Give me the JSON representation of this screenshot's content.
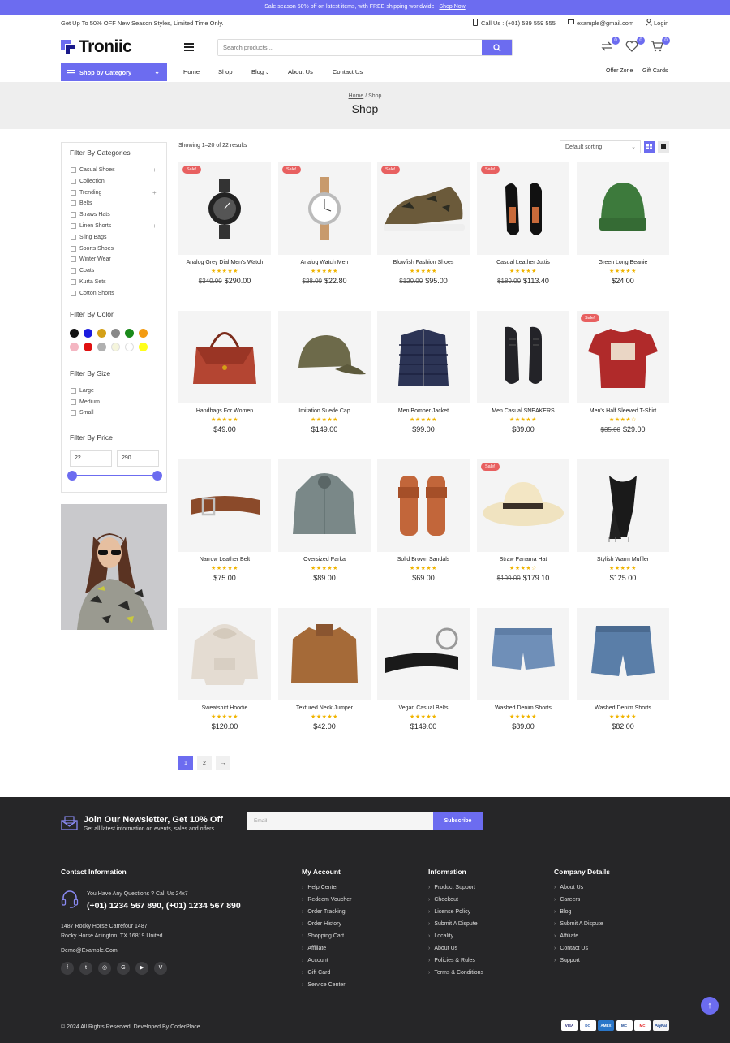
{
  "announcement": {
    "text": "Sale season 50% off on latest items, with FREE shipping worldwide",
    "link": "Shop Now"
  },
  "topbar": {
    "promo": "Get Up To 50% OFF New Season Styles, Limited Time Only.",
    "phone": "Call Us : (+01) 589 559 555",
    "email": "example@gmail.com",
    "login": "Login"
  },
  "brand": {
    "name": "Troniic"
  },
  "search": {
    "placeholder": "Search products..."
  },
  "header_icons": {
    "compare_count": "0",
    "wishlist_count": "0",
    "cart_count": "0"
  },
  "category_button": "Shop by Category",
  "nav": [
    "Home",
    "Shop",
    "Blog",
    "About Us",
    "Contact Us"
  ],
  "right_nav": [
    "Offer Zone",
    "Gift Cards"
  ],
  "hero": {
    "crumb_home": "Home",
    "crumb_sep": "/",
    "crumb_current": "Shop",
    "title": "Shop"
  },
  "filters": {
    "categories_title": "Filter By Categories",
    "categories": [
      "Casual Shoes",
      "Collection",
      "Trending",
      "Belts",
      "Straws Hats",
      "Linen Shorts",
      "Sling Bags",
      "Sports Shoes",
      "Winter Wear",
      "Coats",
      "Kurta Sets",
      "Cotton Shorts"
    ],
    "color_title": "Filter By Color",
    "colors": [
      "#111111",
      "#1a1adf",
      "#d4a017",
      "#888888",
      "#1a8a1a",
      "#f39c12",
      "#f4b6c2",
      "#e01010",
      "#b0b0b0",
      "#f5f5dc",
      "#ffffff",
      "#ffff1a"
    ],
    "size_title": "Filter By Size",
    "sizes": [
      "Large",
      "Medium",
      "Small"
    ],
    "price_title": "Filter By Price",
    "price_min": "22",
    "price_max": "290"
  },
  "results": {
    "text": "Showing 1–20 of 22 results",
    "sort": "Default sorting"
  },
  "products": [
    {
      "name": "Analog Grey Dial Men's Watch",
      "old": "$340.00",
      "price": "$290.00",
      "sale": "Sale!",
      "rating": 5
    },
    {
      "name": "Analog Watch Men",
      "old": "$28.00",
      "price": "$22.80",
      "sale": "Sale!",
      "rating": 5
    },
    {
      "name": "Blowfish Fashion Shoes",
      "old": "$120.00",
      "price": "$95.00",
      "sale": "Sale!",
      "rating": 5
    },
    {
      "name": "Casual Leather Juttis",
      "old": "$189.00",
      "price": "$113.40",
      "sale": "Sale!",
      "rating": 5
    },
    {
      "name": "Green Long Beanie",
      "old": "",
      "price": "$24.00",
      "sale": "",
      "rating": 5
    },
    {
      "name": "Handbags For Women",
      "old": "",
      "price": "$49.00",
      "sale": "",
      "rating": 5
    },
    {
      "name": "Imitation Suede Cap",
      "old": "",
      "price": "$149.00",
      "sale": "",
      "rating": 5
    },
    {
      "name": "Men Bomber Jacket",
      "old": "",
      "price": "$99.00",
      "sale": "",
      "rating": 5
    },
    {
      "name": "Men Casual SNEAKERS",
      "old": "",
      "price": "$89.00",
      "sale": "",
      "rating": 5
    },
    {
      "name": "Men's Half Sleeved T-Shirt",
      "old": "$35.00",
      "price": "$29.00",
      "sale": "Sale!",
      "rating": 4
    },
    {
      "name": "Narrow Leather Belt",
      "old": "",
      "price": "$75.00",
      "sale": "",
      "rating": 5
    },
    {
      "name": "Oversized Parka",
      "old": "",
      "price": "$89.00",
      "sale": "",
      "rating": 5
    },
    {
      "name": "Solid Brown Sandals",
      "old": "",
      "price": "$69.00",
      "sale": "",
      "rating": 5
    },
    {
      "name": "Straw Panama Hat",
      "old": "$199.00",
      "price": "$179.10",
      "sale": "Sale!",
      "rating": 4
    },
    {
      "name": "Stylish Warm Muffler",
      "old": "",
      "price": "$125.00",
      "sale": "",
      "rating": 5
    },
    {
      "name": "Sweatshirt Hoodie",
      "old": "",
      "price": "$120.00",
      "sale": "",
      "rating": 5
    },
    {
      "name": "Textured Neck Jumper",
      "old": "",
      "price": "$42.00",
      "sale": "",
      "rating": 5
    },
    {
      "name": "Vegan Casual Belts",
      "old": "",
      "price": "$149.00",
      "sale": "",
      "rating": 5
    },
    {
      "name": "Washed Denim Shorts",
      "old": "",
      "price": "$89.00",
      "sale": "",
      "rating": 5
    },
    {
      "name": "Washed Denim Shorts",
      "old": "",
      "price": "$82.00",
      "sale": "",
      "rating": 5
    }
  ],
  "pagination": {
    "p1": "1",
    "p2": "2",
    "next": "→"
  },
  "newsletter": {
    "title": "Join Our Newsletter, Get 10% Off",
    "sub": "Get all latest information on events, sales and offers",
    "placeholder": "Email",
    "button": "Subscribe"
  },
  "contact": {
    "title": "Contact Information",
    "question": "You Have Any Questions ? Call Us 24x7",
    "phones": "(+01) 1234 567 890, (+01) 1234 567 890",
    "address1": "1487 Rocky Horse Carrefour 1487",
    "address2": "Rocky Horse Arlington, TX 16819 United",
    "email": "Demo@Example.Com",
    "social": [
      "f",
      "t",
      "◎",
      "G",
      "▶",
      "V"
    ]
  },
  "my_account": {
    "title": "My Account",
    "links": [
      "Help Center",
      "Redeem Voucher",
      "Order Tracking",
      "Order History",
      "Shopping Cart",
      "Affiliate",
      "Account",
      "Gift Card",
      "Service Center"
    ]
  },
  "information": {
    "title": "Information",
    "links": [
      "Product Support",
      "Checkout",
      "License Policy",
      "Submit A Dispute",
      "Locality",
      "About Us",
      "Policies & Rules",
      "Terms & Conditions"
    ]
  },
  "company": {
    "title": "Company Details",
    "links": [
      "About Us",
      "Careers",
      "Blog",
      "Submit A Dispute",
      "Affiliate",
      "Contact Us",
      "Support"
    ]
  },
  "copyright": "© 2024 All Rights Reserved. Developed By CoderPlace",
  "payments": [
    "VISA",
    "DC",
    "AMEX",
    "MC",
    "MC",
    "PayPal"
  ]
}
